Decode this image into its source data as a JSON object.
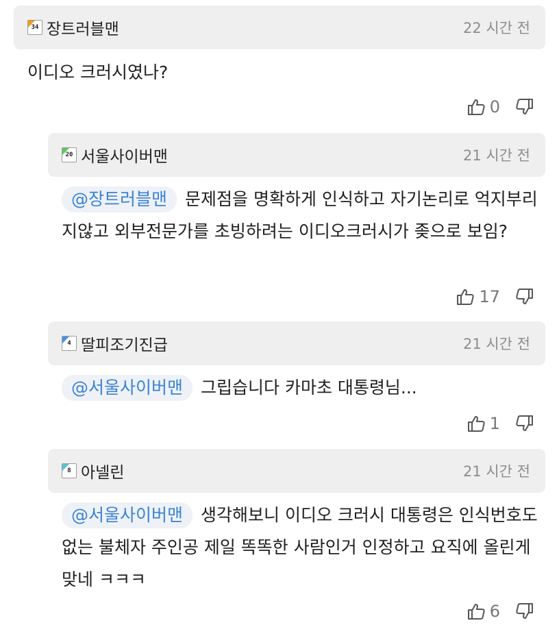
{
  "comments": [
    {
      "badge": "34",
      "badge_color": "#f39c12",
      "name": "장트러블맨",
      "time": "22 시간 전",
      "mention": "",
      "text": "이디오 크러시였나?",
      "likes": "0"
    },
    {
      "badge": "20",
      "badge_color": "#5cc85c",
      "name": "서울사이버맨",
      "time": "21 시간 전",
      "mention": "@장트러블맨",
      "text": "문제점을 명확하게 인식하고 자기논리로 억지부리지않고 외부전문가를 초빙하려는 이디오크러시가 좆으로 보임?",
      "likes": "17"
    },
    {
      "badge": "4",
      "badge_color": "#4a90e2",
      "name": "딸피조기진급",
      "time": "21 시간 전",
      "mention": "@서울사이버맨",
      "text": "그립습니다 카마초 대통령님...",
      "likes": "1"
    },
    {
      "badge": "8",
      "badge_color": "#5bc0de",
      "name": "아넬린",
      "time": "21 시간 전",
      "mention": "@서울사이버맨",
      "text": "생각해보니 이디오 크러시 대통령은 인식번호도 없는 불체자 주인공 제일 똑똑한 사람인거 인정하고 요직에 올린게 맞네 ㅋㅋㅋ",
      "likes": "6"
    }
  ],
  "icons": {
    "like": "thumbs-up-icon",
    "dislike": "thumbs-down-icon"
  }
}
